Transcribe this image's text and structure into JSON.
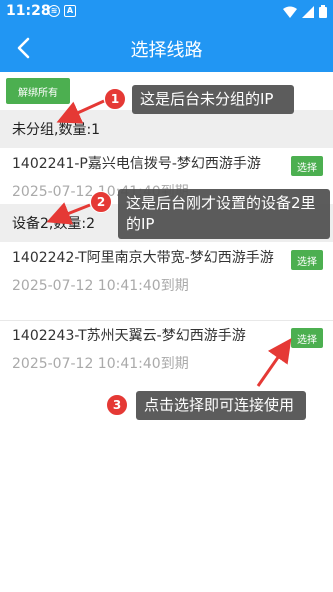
{
  "status_bar": {
    "time": "11:28",
    "left_icons": [
      "data-saver-icon",
      "alert-icon"
    ],
    "left_icon_glyphs": [
      "≋",
      "A"
    ]
  },
  "app_bar": {
    "title": "选择线路",
    "background_color": "#2196f3"
  },
  "actions": {
    "unbind_all_label": "解绑所有",
    "button_color": "#4caf50"
  },
  "groups": [
    {
      "header": "未分组,数量:1",
      "lines": [
        {
          "name": "1402241-P嘉兴电信拨号-梦幻西游手游",
          "expire": "2025-07-12 10:41:40到期",
          "select_label": "选择"
        }
      ]
    },
    {
      "header": "设备2,数量:2",
      "lines": [
        {
          "name": "1402242-T阿里南京大带宽-梦幻西游手游",
          "expire": "2025-07-12 10:41:40到期",
          "select_label": "选择"
        },
        {
          "name": "1402243-T苏州天翼云-梦幻西游手游",
          "expire": "2025-07-12 10:41:40到期",
          "select_label": "选择"
        }
      ]
    }
  ],
  "annotations": [
    {
      "number": "1",
      "text": "这是后台未分组的IP"
    },
    {
      "number": "2",
      "text": "这是后台刚才设置的设备2里的IP"
    },
    {
      "number": "3",
      "text": "点击选择即可连接使用"
    }
  ],
  "annotation_colors": {
    "badge": "#e53935",
    "arrow": "#e53935"
  }
}
